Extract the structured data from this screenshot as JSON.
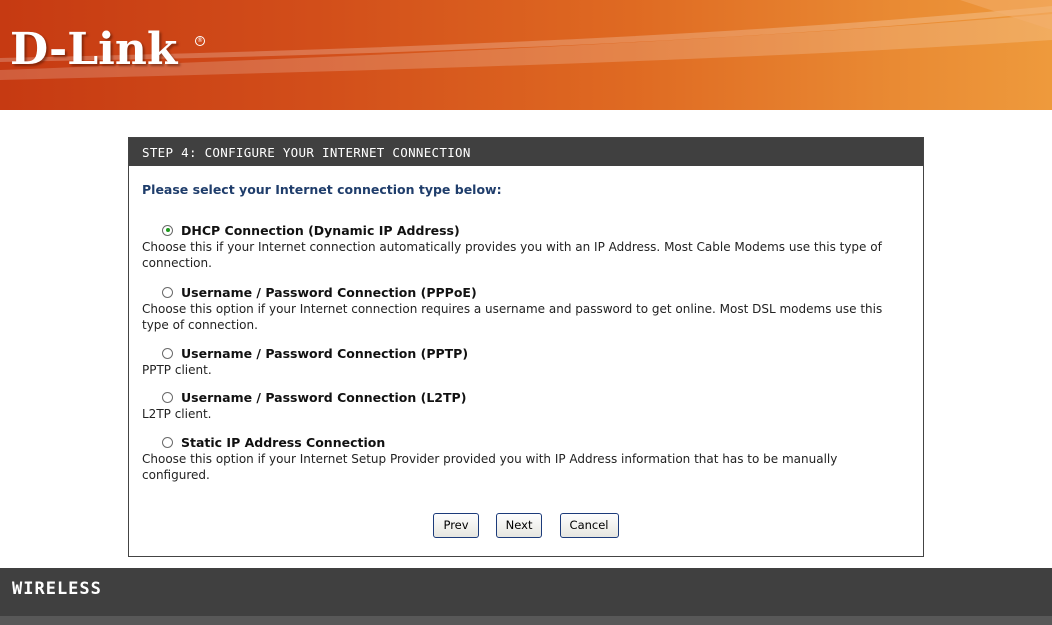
{
  "header": {
    "logo_text": "D-Link",
    "registered_mark": "®"
  },
  "panel": {
    "title": "STEP 4: CONFIGURE YOUR INTERNET CONNECTION",
    "prompt": "Please select your Internet connection type below:"
  },
  "options": [
    {
      "label": "DHCP Connection (Dynamic IP Address)",
      "description": "Choose this if your Internet connection automatically provides you with an IP Address. Most Cable Modems use this type of connection.",
      "selected": true
    },
    {
      "label": "Username / Password Connection (PPPoE)",
      "description": "Choose this option if your Internet connection requires a username and password to get online. Most DSL modems use this type of connection.",
      "selected": false
    },
    {
      "label": "Username / Password Connection (PPTP)",
      "description": "PPTP client.",
      "selected": false
    },
    {
      "label": "Username / Password Connection (L2TP)",
      "description": "L2TP client.",
      "selected": false
    },
    {
      "label": "Static IP Address Connection",
      "description": "Choose this option if your Internet Setup Provider provided you with IP Address information that has to be manually configured.",
      "selected": false
    }
  ],
  "buttons": {
    "prev": "Prev",
    "next": "Next",
    "cancel": "Cancel"
  },
  "footer": {
    "text": "WIRELESS"
  },
  "colors": {
    "header_orange": "#d9541c",
    "panel_title_bg": "#404040",
    "prompt_blue": "#1f3d6b",
    "radio_dot": "#1e9a1e",
    "button_border": "#1c3b7a"
  }
}
